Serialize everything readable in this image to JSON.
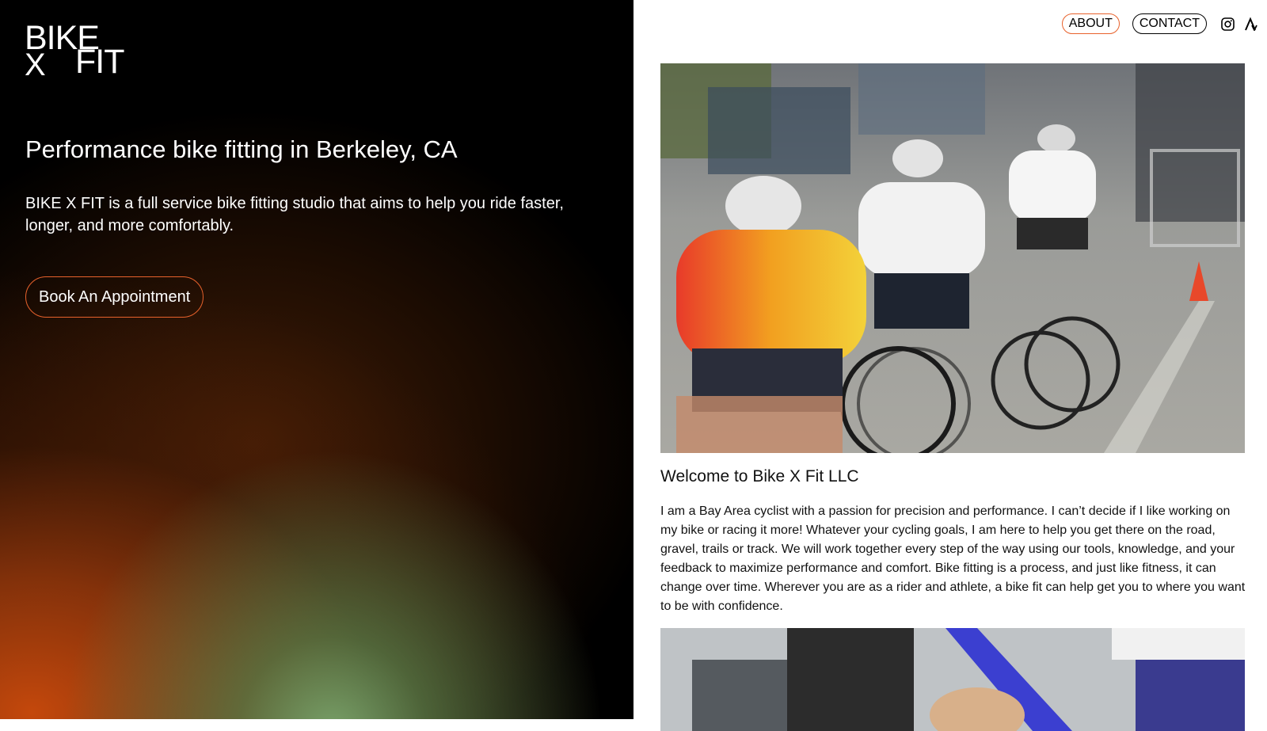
{
  "brand": {
    "logo_line1": "BIKE",
    "logo_x": "X",
    "logo_line2": "FIT"
  },
  "hero": {
    "title": "Performance bike fitting in Berkeley, CA",
    "description": "BIKE X FIT is a full service bike fitting studio that aims to help you ride faster, longer, and more comfortably.",
    "cta_label": "Book An Appointment"
  },
  "nav": {
    "about_label": "ABOUT",
    "contact_label": "CONTACT",
    "icons": [
      "instagram-icon",
      "strava-icon"
    ]
  },
  "main": {
    "welcome_title": "Welcome to Bike X Fit LLC",
    "welcome_body": "I am a Bay Area cyclist with a passion for precision and performance. I can’t decide if I like working on my bike or racing it more! Whatever your cycling goals, I am here to help you get there on the road, gravel, trails or track. We will work together every step of the way using our tools, knowledge, and your feedback to maximize performance and comfort. Bike fitting is a process, and just like fitness, it can change over time. Wherever you are as a rider and athlete, a bike fit can help get you to where you want to be with confidence."
  },
  "colors": {
    "accent": "#e8622c",
    "background_left": "#000000",
    "text_dark": "#111111"
  }
}
